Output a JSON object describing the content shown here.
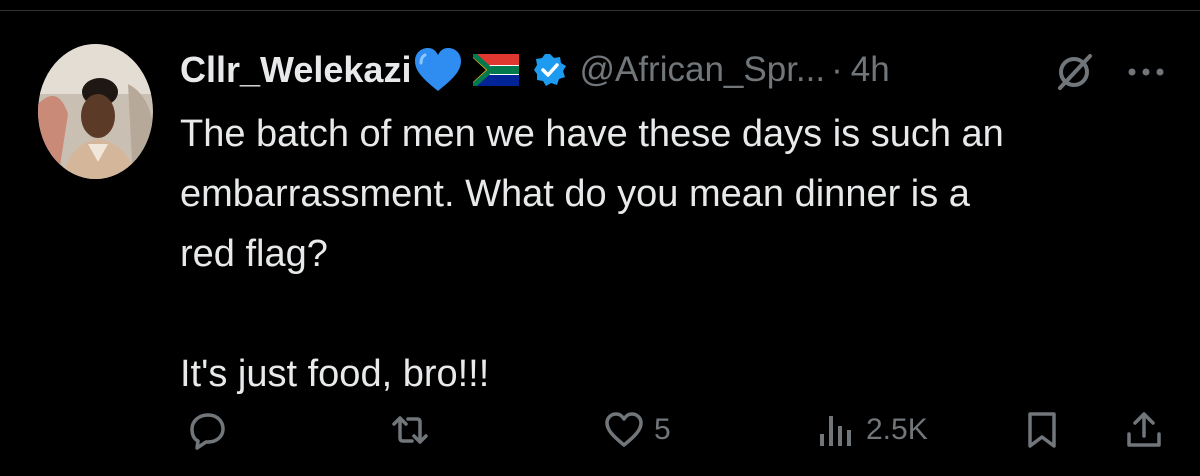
{
  "tweet": {
    "display_name": "Cllr_Welekazi",
    "handle": "@African_Spr...",
    "separator": "·",
    "time": "4h",
    "text_lines": [
      "The batch of men we have these days is such an",
      "embarrassment.  What do you mean dinner is a",
      "red flag?",
      "It's just food, bro!!!"
    ],
    "icons": {
      "name_emoji": "blue-heart-icon",
      "flag": "south-africa-flag-icon",
      "badge": "verified-badge-icon",
      "grok": "grok-icon",
      "more": "more-icon"
    }
  },
  "actions": {
    "reply": {
      "icon": "reply-icon",
      "count": ""
    },
    "repost": {
      "icon": "repost-icon",
      "count": ""
    },
    "like": {
      "icon": "like-icon",
      "count": "5"
    },
    "views": {
      "icon": "views-icon",
      "count": "2.5K"
    },
    "bookmark": {
      "icon": "bookmark-icon"
    },
    "share": {
      "icon": "share-icon"
    }
  },
  "colors": {
    "background": "#000000",
    "text_primary": "#e7e9ea",
    "text_secondary": "#71767b",
    "verified_blue": "#1d9bf0",
    "heart_blue": "#2f8cf0"
  }
}
